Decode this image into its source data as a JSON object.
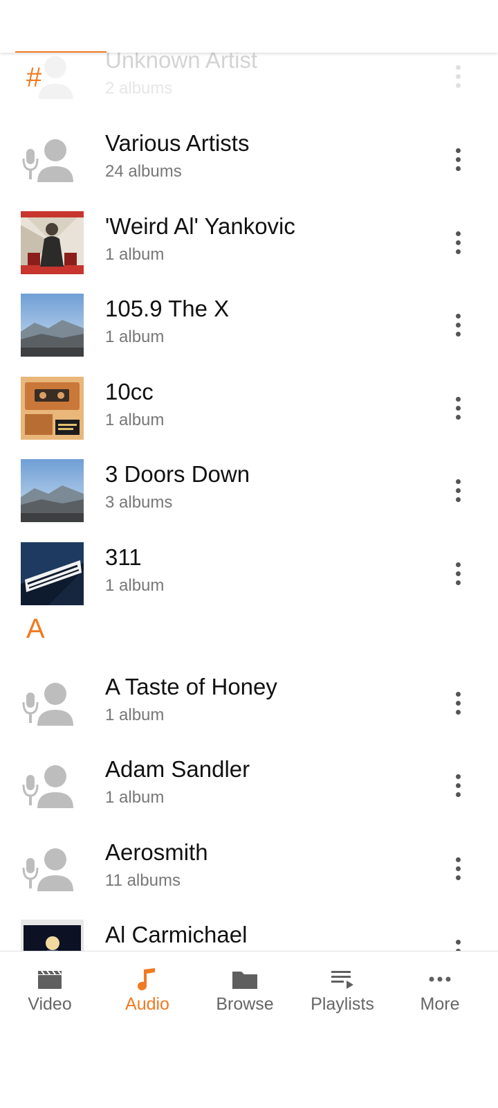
{
  "colors": {
    "accent": "#f07a22",
    "icon_gray": "#bdbdbd",
    "nav_gray": "#5f5f5f"
  },
  "sections": {
    "hash": "#",
    "a": "A"
  },
  "artists": [
    {
      "name": "Unknown Artist",
      "count": "2 albums",
      "icon": "artist-placeholder-icon"
    },
    {
      "name": "Various Artists",
      "count": "24 albums",
      "icon": "artist-placeholder-icon"
    },
    {
      "name": "'Weird Al' Yankovic",
      "count": "1 album",
      "icon": "album-cover-image"
    },
    {
      "name": "105.9 The X",
      "count": "1 album",
      "icon": "album-cover-image"
    },
    {
      "name": "10cc",
      "count": "1 album",
      "icon": "album-cover-image"
    },
    {
      "name": "3 Doors Down",
      "count": "3 albums",
      "icon": "album-cover-image"
    },
    {
      "name": "311",
      "count": "1 album",
      "icon": "album-cover-image"
    },
    {
      "name": "A Taste of Honey",
      "count": "1 album",
      "icon": "artist-placeholder-icon"
    },
    {
      "name": "Adam Sandler",
      "count": "1 album",
      "icon": "artist-placeholder-icon"
    },
    {
      "name": "Aerosmith",
      "count": "11 albums",
      "icon": "artist-placeholder-icon"
    },
    {
      "name": "Al Carmichael",
      "count": "",
      "icon": "album-cover-image"
    }
  ],
  "nav": {
    "video": "Video",
    "audio": "Audio",
    "browse": "Browse",
    "playlists": "Playlists",
    "more": "More"
  }
}
